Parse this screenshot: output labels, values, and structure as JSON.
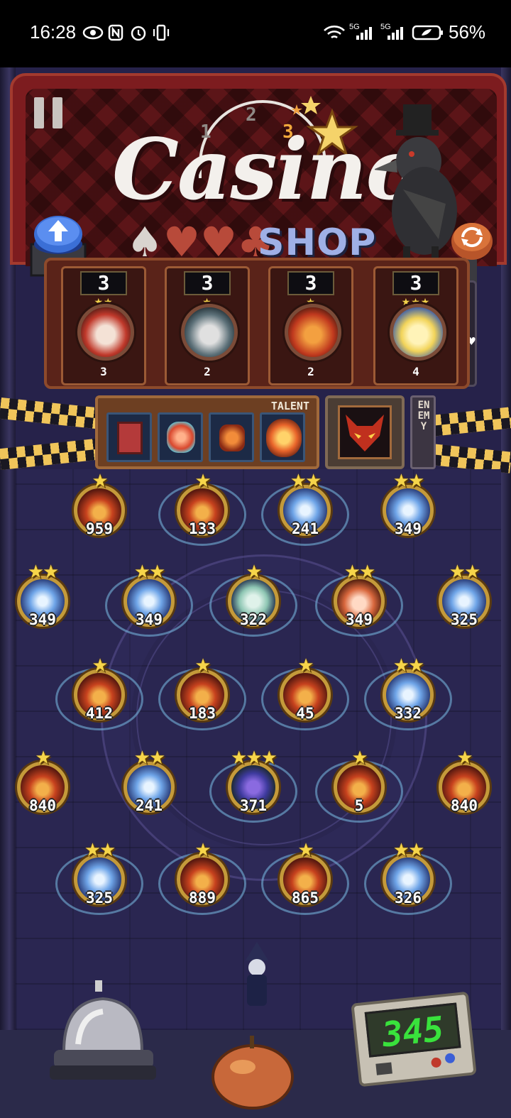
{
  "status_bar": {
    "time": "16:28",
    "battery": "56%",
    "network_1": "5G",
    "network_2": "5G"
  },
  "sign": {
    "title": "Casino",
    "subtitle": "SHOP",
    "progress_steps": [
      "1",
      "2",
      "3"
    ],
    "current_step": "3",
    "colors": {
      "sign_red": "#7d1c1f",
      "title_white": "#f3f0ec",
      "shop_blue": "#9fb0e6"
    }
  },
  "controls": {
    "up_button_icon": "arrow-up-icon",
    "reroll_button_icon": "refresh-icon",
    "pause_icon": "pause-icon",
    "hearts": "1",
    "heart_icon": "heart-icon"
  },
  "slots": [
    {
      "cost": "3",
      "count": "3",
      "stars": "★★",
      "portrait": "red-haired-hero"
    },
    {
      "cost": "3",
      "count": "2",
      "stars": "★",
      "portrait": "masked-knight"
    },
    {
      "cost": "3",
      "count": "2",
      "stars": "★",
      "portrait": "fire-demon"
    },
    {
      "cost": "3",
      "count": "4",
      "stars": "★★★",
      "portrait": "blonde-girl"
    }
  ],
  "talent": {
    "label": "TALENT",
    "items": [
      "red-cabinet",
      "crystal-mask",
      "fire-rooster",
      "flame-burst"
    ]
  },
  "enemy": {
    "label": "ENEMY",
    "portrait": "red-dragon"
  },
  "board": {
    "units": [
      {
        "value": "959",
        "stars": "★",
        "kind": "fire",
        "ring": false
      },
      {
        "value": "133",
        "stars": "★",
        "kind": "fire",
        "ring": true
      },
      {
        "value": "241",
        "stars": "★★",
        "kind": "ice",
        "ring": true
      },
      {
        "value": "349",
        "stars": "★★",
        "kind": "ice",
        "ring": false
      },
      {
        "value": "349",
        "stars": "★★",
        "kind": "ice",
        "ring": false
      },
      {
        "value": "349",
        "stars": "★★",
        "kind": "ice",
        "ring": true
      },
      {
        "value": "322",
        "stars": "★",
        "kind": "ghost",
        "ring": true
      },
      {
        "value": "349",
        "stars": "★★",
        "kind": "girl",
        "ring": true
      },
      {
        "value": "325",
        "stars": "★★",
        "kind": "ice",
        "ring": false
      },
      {
        "value": "412",
        "stars": "★",
        "kind": "fire",
        "ring": true
      },
      {
        "value": "183",
        "stars": "★",
        "kind": "fire",
        "ring": true
      },
      {
        "value": "45",
        "stars": "★",
        "kind": "fire",
        "ring": true
      },
      {
        "value": "332",
        "stars": "★★",
        "kind": "ice",
        "ring": true
      },
      {
        "value": "840",
        "stars": "★",
        "kind": "fire",
        "ring": false
      },
      {
        "value": "241",
        "stars": "★★",
        "kind": "ice",
        "ring": false
      },
      {
        "value": "371",
        "stars": "★★★",
        "kind": "flower",
        "ring": true
      },
      {
        "value": "5",
        "stars": "★",
        "kind": "fire",
        "ring": true
      },
      {
        "value": "840",
        "stars": "★",
        "kind": "fire",
        "ring": false
      },
      {
        "value": "325",
        "stars": "★★",
        "kind": "ice",
        "ring": true
      },
      {
        "value": "889",
        "stars": "★",
        "kind": "fire",
        "ring": true
      },
      {
        "value": "865",
        "stars": "★",
        "kind": "fire",
        "ring": true
      },
      {
        "value": "326",
        "stars": "★★",
        "kind": "ice",
        "ring": true
      }
    ]
  },
  "bottom": {
    "gold": "345",
    "bell_icon": "service-bell-icon",
    "peach_icon": "peach-icon",
    "wizard_icon": "wizard-character-icon"
  }
}
